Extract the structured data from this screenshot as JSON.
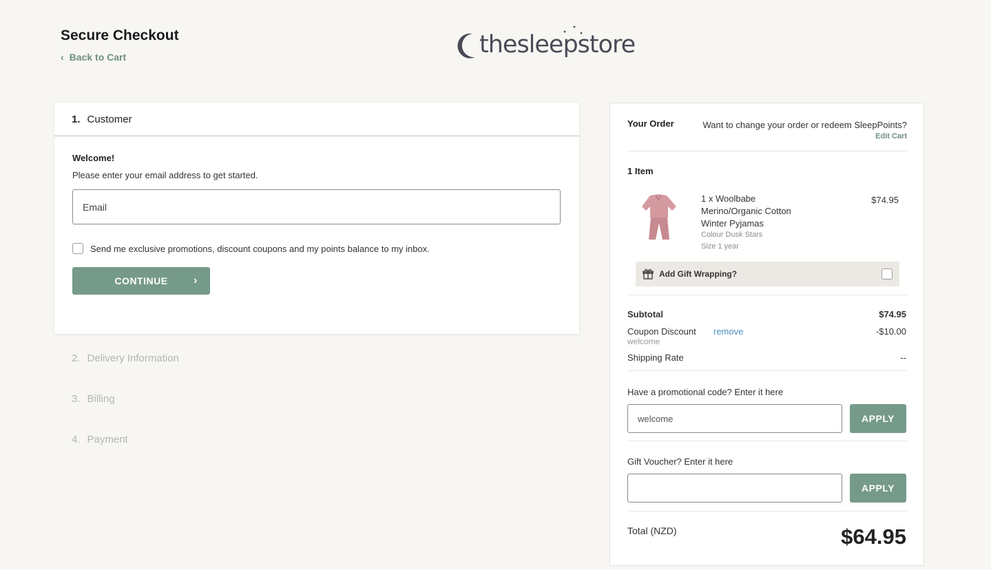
{
  "header": {
    "title": "Secure Checkout",
    "back_label": "Back to Cart",
    "logo_text": "thesleepstore"
  },
  "checkout": {
    "step1": {
      "num": "1.",
      "label": "Customer"
    },
    "welcome": "Welcome!",
    "instructions": "Please enter your email address to get started.",
    "email_placeholder": "Email",
    "promo_optin": "Send me exclusive promotions, discount coupons and my points balance to my inbox.",
    "continue_label": "CONTINUE",
    "steps": [
      {
        "num": "2.",
        "label": "Delivery Information"
      },
      {
        "num": "3.",
        "label": "Billing"
      },
      {
        "num": "4.",
        "label": "Payment"
      }
    ]
  },
  "order": {
    "title": "Your Order",
    "change_prompt": "Want to change your order or redeem SleepPoints?",
    "edit_cart": "Edit Cart",
    "items_count": "1 Item",
    "item": {
      "name": "1 x Woolbabe Merino/Organic Cotton Winter Pyjamas",
      "price": "$74.95",
      "colour": "Colour Dusk Stars",
      "size": "Size 1 year"
    },
    "gift_wrap_label": "Add Gift Wrapping?",
    "subtotal_label": "Subtotal",
    "subtotal_value": "$74.95",
    "coupon_label": "Coupon Discount",
    "coupon_remove": "remove",
    "coupon_code": "welcome",
    "coupon_value": "-$10.00",
    "shipping_label": "Shipping Rate",
    "shipping_value": "--",
    "promo_code_label": "Have a promotional code? Enter it here",
    "promo_code_value": "welcome",
    "apply_label": "APPLY",
    "voucher_label": "Gift Voucher? Enter it here",
    "voucher_value": "",
    "total_label": "Total (NZD)",
    "total_value": "$64.95"
  },
  "colors": {
    "accent": "#769a8a",
    "link": "#4a8fc0",
    "background": "#f7f6f3"
  }
}
